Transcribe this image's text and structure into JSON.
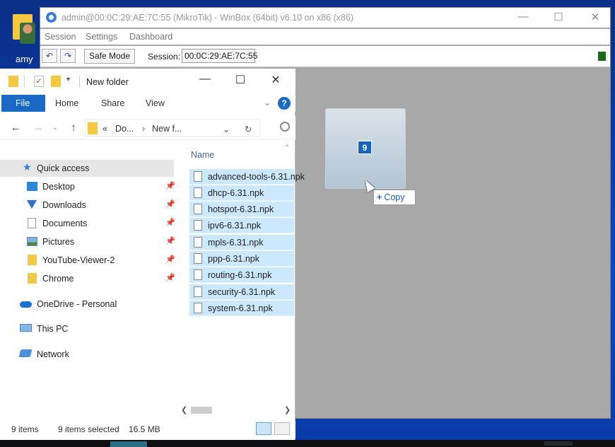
{
  "desktop": {
    "icon_label": "amy"
  },
  "winbox": {
    "title": "admin@00:0C:29:AE:7C:55 (MikroTik) - WinBox (64bit) v6.10 on x86 (x86)",
    "menu": [
      "Session",
      "Settings",
      "Dashboard"
    ],
    "toolbar": {
      "undo_icon": "undo-icon",
      "redo_icon": "redo-icon",
      "safe_mode_label": "Safe Mode",
      "session_label": "Session:",
      "session_value": "00:0C:29:AE:7C:55"
    },
    "drag": {
      "count": "9",
      "tooltip_plus": "+",
      "tooltip_label": "Copy"
    }
  },
  "explorer": {
    "title": "New folder",
    "ribbon_tabs": [
      "File",
      "Home",
      "Share",
      "View"
    ],
    "help_label": "?",
    "address": {
      "prefix": "«",
      "crumbs": [
        "Do...",
        "New f..."
      ]
    },
    "nav": {
      "quick_access": "Quick access",
      "items": [
        "Desktop",
        "Downloads",
        "Documents",
        "Pictures",
        "YouTube-Viewer-2",
        "Chrome"
      ],
      "onedrive": "OneDrive - Personal",
      "this_pc": "This PC",
      "network": "Network"
    },
    "column_name": "Name",
    "files": [
      "advanced-tools-6.31.npk",
      "dhcp-6.31.npk",
      "hotspot-6.31.npk",
      "ipv6-6.31.npk",
      "mpls-6.31.npk",
      "ppp-6.31.npk",
      "routing-6.31.npk",
      "security-6.31.npk",
      "system-6.31.npk"
    ],
    "status": {
      "items": "9 items",
      "selected": "9 items selected",
      "size": "16.5 MB"
    }
  },
  "colors": {
    "accent": "#1a69c4",
    "selection": "#cce8ff",
    "winbox_bg": "#a8a8a8",
    "desktop": "#0b47c4"
  }
}
